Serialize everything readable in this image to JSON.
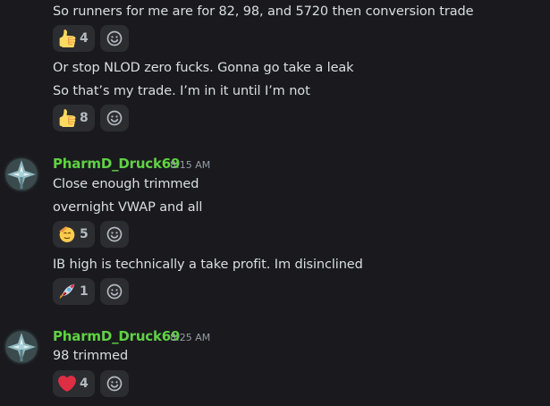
{
  "messages_top": [
    {
      "text": "So runners for me are for 82, 98, and 5720 then conversion trade"
    },
    {
      "text": "Or stop NLOD zero fucks. Gonna go take a leak"
    },
    {
      "text": "So that’s my trade. I’m in it until I’m not"
    }
  ],
  "reactions": {
    "r1": {
      "emoji": "thumbs-up",
      "count": "4"
    },
    "r2": {
      "emoji": "thumbs-up",
      "count": "8"
    },
    "r3": {
      "emoji": "saluting-face",
      "count": "5"
    },
    "r4": {
      "emoji": "rocket",
      "count": "1"
    },
    "r5": {
      "emoji": "red-heart",
      "count": "4"
    }
  },
  "group1": {
    "username": "PharmD_Druck69",
    "timestamp": "8:15 AM",
    "lines": [
      "Close enough trimmed",
      "overnight VWAP and all",
      "IB high is technically a take profit. Im disinclined"
    ]
  },
  "group2": {
    "username": "PharmD_Druck69",
    "timestamp": "8:25 AM",
    "lines": [
      "98 trimmed"
    ]
  },
  "colors": {
    "background": "#1a1a1e",
    "username": "#5fd243",
    "reaction_bg": "#2b2d31"
  }
}
